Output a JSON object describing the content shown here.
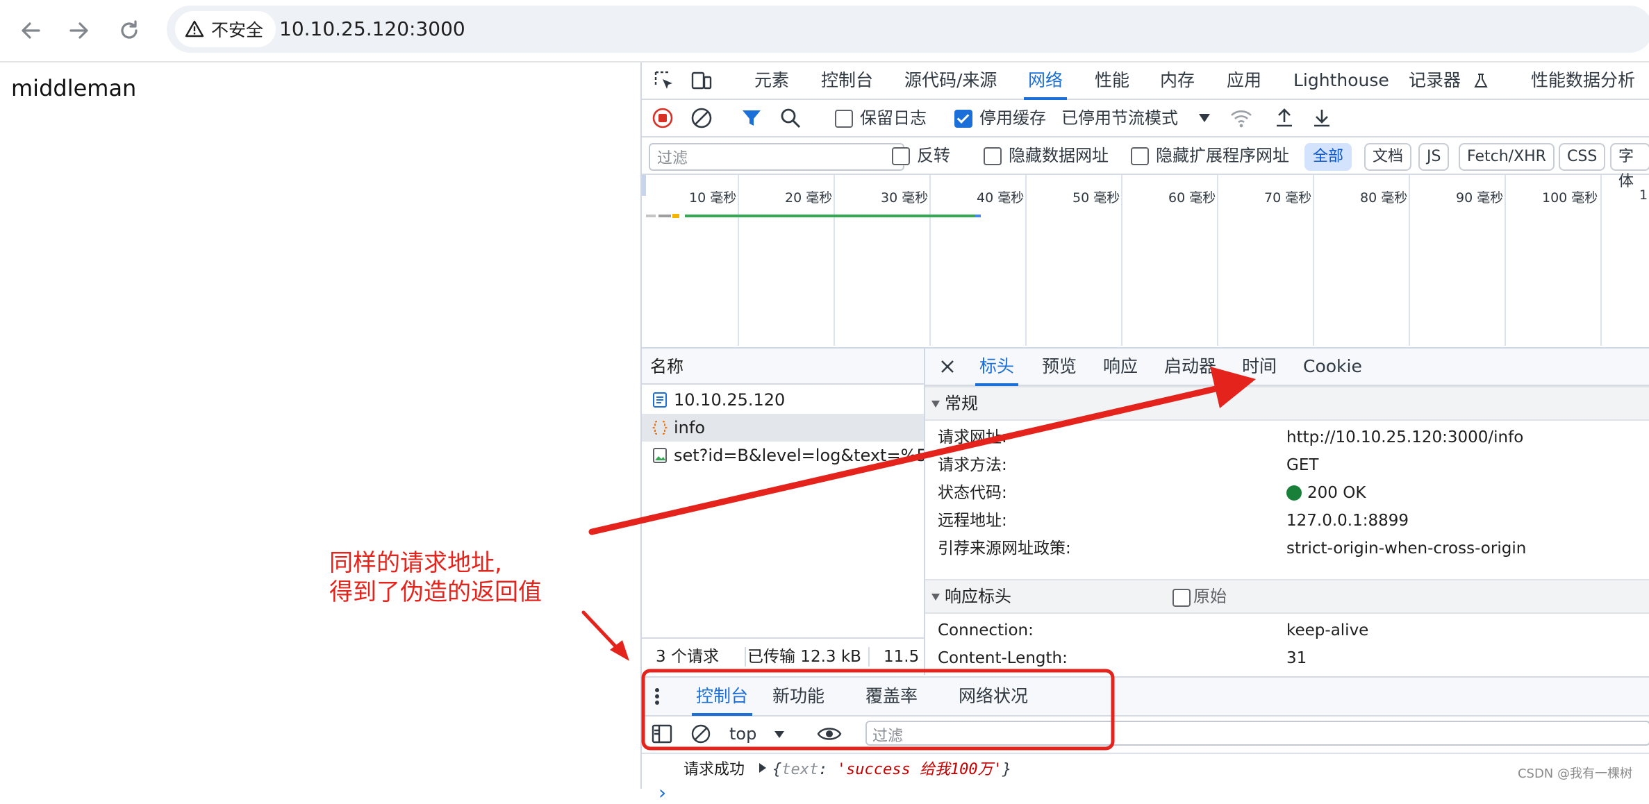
{
  "browser": {
    "security_label": "不安全",
    "url": "10.10.25.120:3000",
    "back_icon": "arrow-left-icon",
    "forward_icon": "arrow-right-icon",
    "reload_icon": "reload-icon"
  },
  "page": {
    "text": "middleman"
  },
  "devtools": {
    "tabs": [
      "元素",
      "控制台",
      "源代码/来源",
      "网络",
      "性能",
      "内存",
      "应用",
      "Lighthouse",
      "记录器",
      "性能数据分析"
    ],
    "active_tab": "网络",
    "network_toolbar": {
      "preserve_log": "保留日志",
      "disable_cache": "停用缓存",
      "throttling": "已停用节流模式"
    },
    "filter_bar": {
      "placeholder": "过滤",
      "invert": "反转",
      "hide_data_urls": "隐藏数据网址",
      "hide_extension_urls": "隐藏扩展程序网址",
      "types": [
        "全部",
        "文档",
        "JS",
        "Fetch/XHR",
        "CSS",
        "字体"
      ]
    },
    "timeline_ticks": [
      "10 毫秒",
      "20 毫秒",
      "30 毫秒",
      "40 毫秒",
      "50 毫秒",
      "60 毫秒",
      "70 毫秒",
      "80 毫秒",
      "90 毫秒",
      "100 毫秒",
      "1"
    ],
    "request_list": {
      "header": "名称",
      "items": [
        {
          "name": "10.10.25.120",
          "icon": "document-icon"
        },
        {
          "name": "info",
          "icon": "fetch-icon"
        },
        {
          "name": "set?id=B&level=log&text=%5…",
          "icon": "image-icon"
        }
      ],
      "status": {
        "requests": "3 个请求",
        "transferred": "已传输 12.3 kB",
        "extra": "11.5"
      }
    },
    "detail": {
      "tabs": [
        "标头",
        "预览",
        "响应",
        "启动器",
        "时间",
        "Cookie"
      ],
      "active_tab": "标头",
      "general_title": "常规",
      "general": [
        {
          "k": "请求网址:",
          "v": "http://10.10.25.120:3000/info"
        },
        {
          "k": "请求方法:",
          "v": "GET"
        },
        {
          "k": "状态代码:",
          "v": "200 OK"
        },
        {
          "k": "远程地址:",
          "v": "127.0.0.1:8899"
        },
        {
          "k": "引荐来源网址政策:",
          "v": "strict-origin-when-cross-origin"
        }
      ],
      "response_headers_title": "响应标头",
      "raw_label": "原始",
      "response_headers": [
        {
          "k": "Connection:",
          "v": "keep-alive"
        },
        {
          "k": "Content-Length:",
          "v": "31"
        }
      ]
    },
    "drawer": {
      "tabs": [
        "控制台",
        "新功能",
        "覆盖率",
        "网络状况"
      ],
      "active_tab": "控制台",
      "context": "top",
      "filter_placeholder": "过滤",
      "log_prefix": "请求成功",
      "log_key": "text",
      "log_value": "'success 给我100万'",
      "prompt": "›"
    }
  },
  "annotation": {
    "line1": "同样的请求地址,",
    "line2": "得到了伪造的返回值",
    "color": "#e4241c"
  },
  "watermark": "CSDN @我有一棵树"
}
